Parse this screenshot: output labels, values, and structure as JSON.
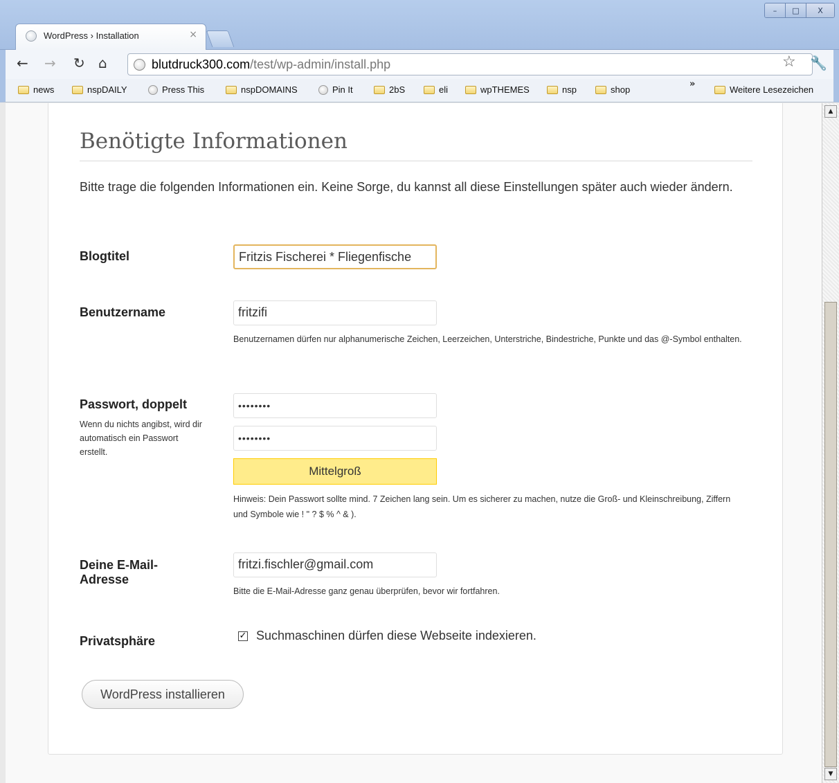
{
  "browser": {
    "tab_title": "WordPress › Installation",
    "tab_close": "×",
    "url_domain": "blutdruck300.com",
    "url_path": "/test/wp-admin/install.php",
    "window_controls": [
      "–",
      "□",
      "X"
    ],
    "bookmarks": [
      {
        "label": "news",
        "icon": "folder-icon"
      },
      {
        "label": "nspDAILY",
        "icon": "folder-icon"
      },
      {
        "label": "Press This",
        "icon": "globe-icon"
      },
      {
        "label": "nspDOMAINS",
        "icon": "folder-icon"
      },
      {
        "label": "Pin It",
        "icon": "globe-icon"
      },
      {
        "label": "2bS",
        "icon": "folder-icon"
      },
      {
        "label": "eli",
        "icon": "folder-icon"
      },
      {
        "label": "wpTHEMES",
        "icon": "folder-icon"
      },
      {
        "label": "nsp",
        "icon": "folder-icon"
      },
      {
        "label": "shop",
        "icon": "folder-icon"
      }
    ],
    "overflow_chevron": "»",
    "other_bookmarks": "Weitere Lesezeichen"
  },
  "form": {
    "heading": "Benötigte Informationen",
    "intro": "Bitte trage die folgenden Informationen ein. Keine Sorge, du kannst all diese Einstellungen später auch wieder ändern.",
    "blog_title_label": "Blogtitel",
    "blog_title_value": "Fritzis Fischerei * Fliegenfische",
    "username_label": "Benutzername",
    "username_value": "fritzifi",
    "username_help": "Benutzernamen dürfen nur alphanumerische Zeichen, Leerzeichen, Unterstriche, Bindestriche, Punkte und das @-Symbol enthalten.",
    "password_label": "Passwort, doppelt",
    "password_sub": "Wenn du nichts angibst, wird dir automatisch ein Passwort erstellt.",
    "password_1": "••••••••",
    "password_2": "••••••••",
    "strength": "Mittelgroß",
    "password_hint": "Hinweis: Dein Passwort sollte mind. 7 Zeichen lang sein. Um es sicherer zu machen, nutze die Groß- und Kleinschreibung, Ziffern und Symbole wie ! \" ? $ % ^ & ).",
    "email_label": "Deine E-Mail-Adresse",
    "email_value": "fritzi.fischler@gmail.com",
    "email_help": "Bitte die E-Mail-Adresse ganz genau überprüfen, bevor wir fortfahren.",
    "privacy_label": "Privatsphäre",
    "privacy_checkbox_label": "Suchmaschinen dürfen diese Webseite indexieren.",
    "submit_label": "WordPress installieren"
  }
}
